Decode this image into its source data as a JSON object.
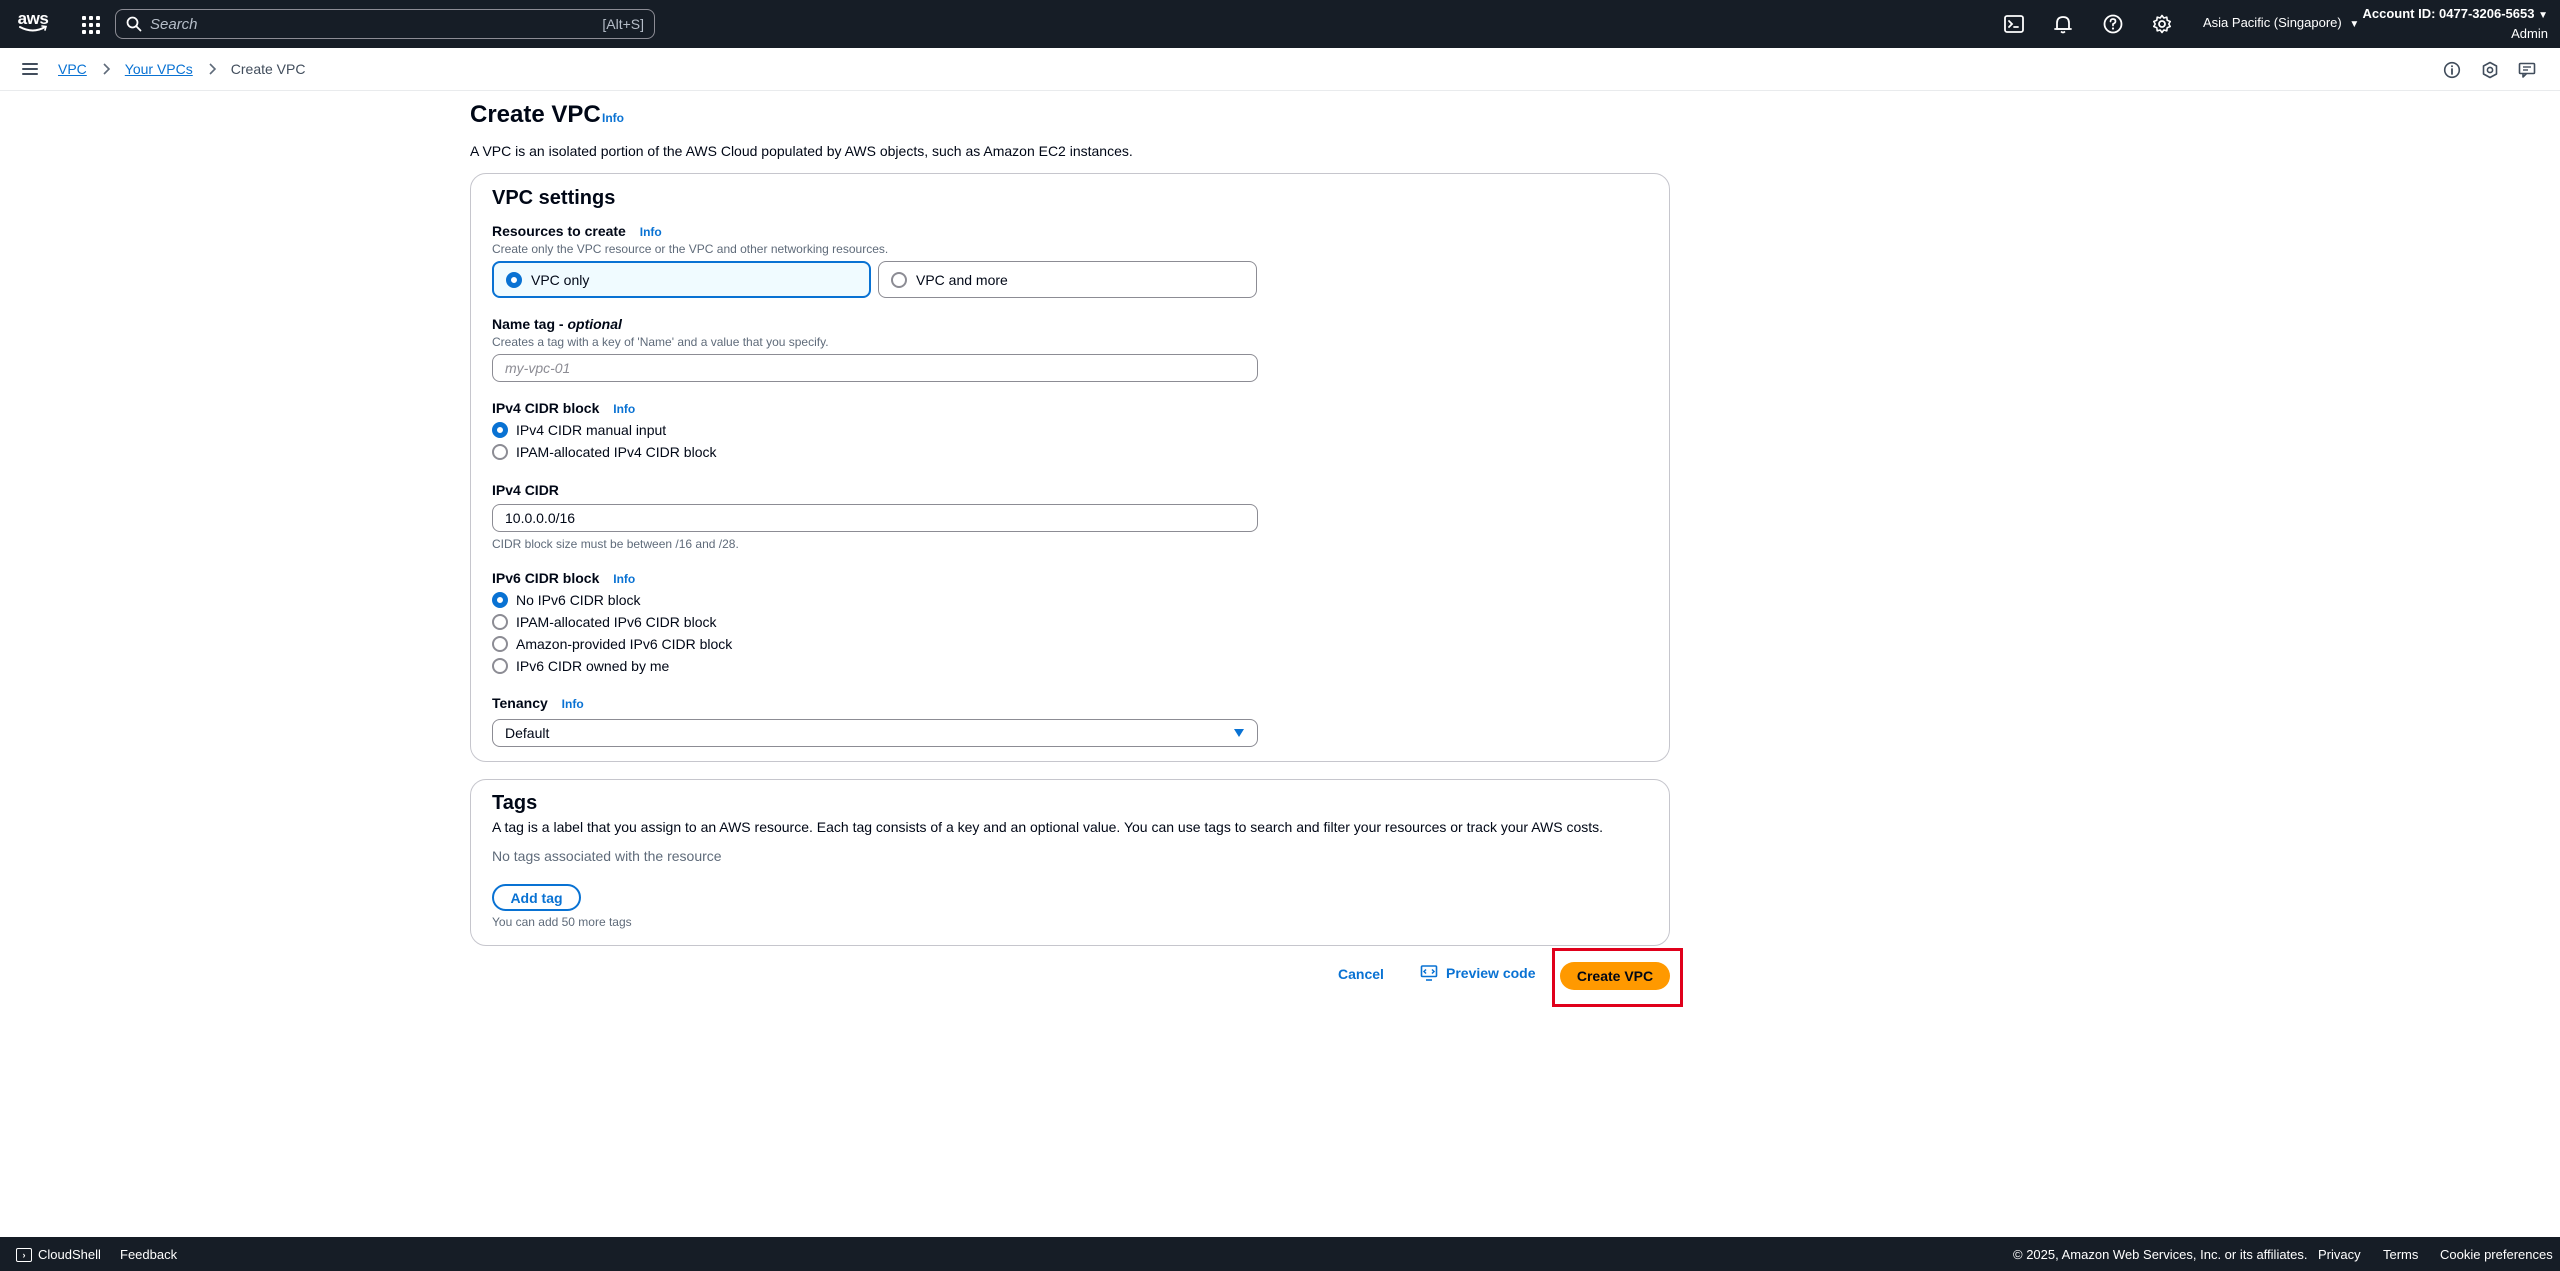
{
  "topnav": {
    "logo_text": "aws",
    "search": {
      "placeholder": "Search",
      "shortcut": "[Alt+S]"
    },
    "region": "Asia Pacific (Singapore)",
    "account_id": "Account ID: 0477-3206-5653",
    "account_role": "Admin"
  },
  "breadcrumb": {
    "items": [
      "VPC",
      "Your VPCs"
    ],
    "current": "Create VPC"
  },
  "page": {
    "title": "Create VPC",
    "info_label": "Info",
    "description": "A VPC is an isolated portion of the AWS Cloud populated by AWS objects, such as Amazon EC2 instances."
  },
  "vpc_settings": {
    "title": "VPC settings",
    "resources": {
      "label": "Resources to create",
      "info": "Info",
      "description": "Create only the VPC resource or the VPC and other networking resources.",
      "options": [
        "VPC only",
        "VPC and more"
      ],
      "selected": "VPC only"
    },
    "name_tag": {
      "label": "Name tag - ",
      "label_optional": "optional",
      "description": "Creates a tag with a key of 'Name' and a value that you specify.",
      "placeholder": "my-vpc-01"
    },
    "ipv4_block": {
      "label": "IPv4 CIDR block",
      "info": "Info",
      "options": [
        "IPv4 CIDR manual input",
        "IPAM-allocated IPv4 CIDR block"
      ],
      "selected": "IPv4 CIDR manual input"
    },
    "ipv4_cidr": {
      "label": "IPv4 CIDR",
      "value": "10.0.0.0/16",
      "constraint": "CIDR block size must be between /16 and /28."
    },
    "ipv6_block": {
      "label": "IPv6 CIDR block",
      "info": "Info",
      "options": [
        "No IPv6 CIDR block",
        "IPAM-allocated IPv6 CIDR block",
        "Amazon-provided IPv6 CIDR block",
        "IPv6 CIDR owned by me"
      ],
      "selected": "No IPv6 CIDR block"
    },
    "tenancy": {
      "label": "Tenancy",
      "info": "Info",
      "value": "Default"
    }
  },
  "tags": {
    "title": "Tags",
    "description": "A tag is a label that you assign to an AWS resource. Each tag consists of a key and an optional value. You can use tags to search and filter your resources or track your AWS costs.",
    "empty": "No tags associated with the resource",
    "add_button": "Add tag",
    "limit": "You can add 50 more tags"
  },
  "actions": {
    "cancel": "Cancel",
    "preview": "Preview code",
    "create": "Create VPC"
  },
  "footer": {
    "cloudshell": "CloudShell",
    "feedback": "Feedback",
    "copyright": "© 2025, Amazon Web Services, Inc. or its affiliates.",
    "privacy": "Privacy",
    "terms": "Terms",
    "cookies": "Cookie preferences"
  },
  "colors": {
    "nav_bg": "#161d26",
    "link": "#0972d3",
    "primary_button": "#ff9900",
    "highlight": "#e0001b"
  }
}
